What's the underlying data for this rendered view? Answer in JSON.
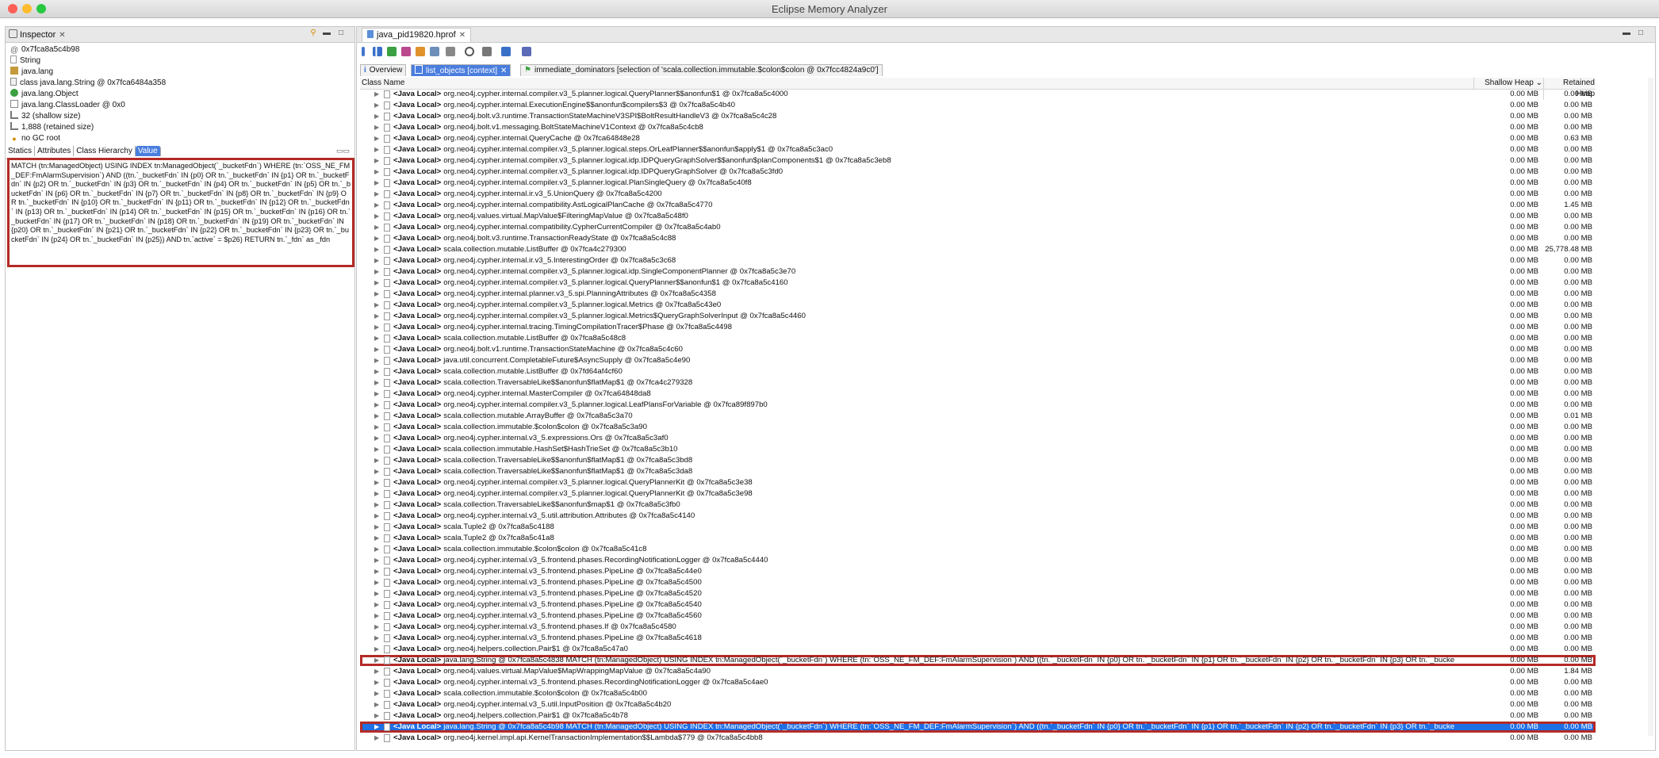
{
  "window": {
    "title": "Eclipse Memory Analyzer"
  },
  "colors": {
    "accent": "#1f6fe5",
    "highlight_outline": "#b32a26",
    "close": "#fd5f57",
    "minimize": "#febc2e",
    "maximize": "#28c840"
  },
  "inspector": {
    "tab_label": "Inspector",
    "lines": [
      {
        "text": "0x7fca8a5c4b98",
        "icon": "address-icon"
      },
      {
        "text": "String",
        "icon": "file-icon"
      },
      {
        "text": "java.lang",
        "icon": "package-icon"
      },
      {
        "text": "class java.lang.String @ 0x7fca6484a358",
        "icon": "class-icon"
      },
      {
        "text": "java.lang.Object",
        "icon": "superclass-icon"
      },
      {
        "text": "java.lang.ClassLoader @ 0x0",
        "icon": "classloader-icon"
      },
      {
        "text": "32 (shallow size)",
        "icon": "size-icon"
      },
      {
        "text": "1,888 (retained size)",
        "icon": "size-icon"
      },
      {
        "text": "no GC root",
        "icon": "gc-root-icon"
      }
    ],
    "subtabs": [
      "Statics",
      "Attributes",
      "Class Hierarchy",
      "Value"
    ],
    "value_text": "MATCH (tn:ManagedObject) USING INDEX tn:ManagedObject(`_bucketFdn`) WHERE (tn:`OSS_NE_FM_DEF:FmAlarmSupervision`) AND ((tn.`_bucketFdn` IN {p0} OR tn.`_bucketFdn` IN {p1} OR tn.`_bucketFdn` IN {p2} OR tn.`_bucketFdn` IN {p3} OR tn.`_bucketFdn` IN {p4} OR tn.`_bucketFdn` IN {p5} OR tn.`_bucketFdn` IN {p6} OR tn.`_bucketFdn` IN {p7} OR tn.`_bucketFdn` IN {p8} OR tn.`_bucketFdn` IN {p9} OR tn.`_bucketFdn` IN {p10} OR tn.`_bucketFdn` IN {p11} OR tn.`_bucketFdn` IN {p12} OR tn.`_bucketFdn` IN {p13} OR tn.`_bucketFdn` IN {p14} OR tn.`_bucketFdn` IN {p15} OR tn.`_bucketFdn` IN {p16} OR tn.`_bucketFdn` IN {p17} OR tn.`_bucketFdn` IN {p18} OR tn.`_bucketFdn` IN {p19} OR tn.`_bucketFdn` IN {p20} OR tn.`_bucketFdn` IN {p21} OR tn.`_bucketFdn` IN {p22} OR tn.`_bucketFdn` IN {p23} OR tn.`_bucketFdn` IN {p24} OR tn.`_bucketFdn` IN {p25}) AND tn.`active` = $p26) RETURN tn.`_fdn` as _fdn"
  },
  "editor": {
    "tab_label": "java_pid19820.hprof",
    "view_tabs": [
      {
        "label": "Overview",
        "icon": "info-icon"
      },
      {
        "label": "list_objects [context]",
        "icon": "list-icon"
      },
      {
        "label": "immediate_dominators [selection of 'scala.collection.immutable.$colon$colon @ 0x7fcc4824a9c0']",
        "icon": "dominator-icon"
      }
    ],
    "columns": {
      "class_name": "Class Name",
      "shallow": "Shallow Heap",
      "retained": "Retained Heap"
    },
    "row_prefix": "<Java Local>",
    "rows": [
      {
        "name": "org.neo4j.cypher.internal.compiler.v3_5.planner.logical.QueryPlanner$$anonfun$1 @ 0x7fca8a5c4000",
        "shallow": "0.00 MB",
        "retained": "0.00 MB"
      },
      {
        "name": "org.neo4j.cypher.internal.ExecutionEngine$$anonfun$compilers$3 @ 0x7fca8a5c4b40",
        "shallow": "0.00 MB",
        "retained": "0.00 MB"
      },
      {
        "name": "org.neo4j.bolt.v3.runtime.TransactionStateMachineV3SPI$BoltResultHandleV3 @ 0x7fca8a5c4c28",
        "shallow": "0.00 MB",
        "retained": "0.00 MB"
      },
      {
        "name": "org.neo4j.bolt.v1.messaging.BoltStateMachineV1Context @ 0x7fca8a5c4cb8",
        "shallow": "0.00 MB",
        "retained": "0.00 MB"
      },
      {
        "name": "org.neo4j.cypher.internal.QueryCache @ 0x7fca64848e28",
        "shallow": "0.00 MB",
        "retained": "0.63 MB"
      },
      {
        "name": "org.neo4j.cypher.internal.compiler.v3_5.planner.logical.steps.OrLeafPlanner$$anonfun$apply$1 @ 0x7fca8a5c3ac0",
        "shallow": "0.00 MB",
        "retained": "0.00 MB"
      },
      {
        "name": "org.neo4j.cypher.internal.compiler.v3_5.planner.logical.idp.IDPQueryGraphSolver$$anonfun$planComponents$1 @ 0x7fca8a5c3eb8",
        "shallow": "0.00 MB",
        "retained": "0.00 MB"
      },
      {
        "name": "org.neo4j.cypher.internal.compiler.v3_5.planner.logical.idp.IDPQueryGraphSolver @ 0x7fca8a5c3fd0",
        "shallow": "0.00 MB",
        "retained": "0.00 MB"
      },
      {
        "name": "org.neo4j.cypher.internal.compiler.v3_5.planner.logical.PlanSingleQuery @ 0x7fca8a5c40f8",
        "shallow": "0.00 MB",
        "retained": "0.00 MB"
      },
      {
        "name": "org.neo4j.cypher.internal.ir.v3_5.UnionQuery @ 0x7fca8a5c4200",
        "shallow": "0.00 MB",
        "retained": "0.00 MB"
      },
      {
        "name": "org.neo4j.cypher.internal.compatibility.AstLogicalPlanCache @ 0x7fca8a5c4770",
        "shallow": "0.00 MB",
        "retained": "1.45 MB"
      },
      {
        "name": "org.neo4j.values.virtual.MapValue$FilteringMapValue @ 0x7fca8a5c48f0",
        "shallow": "0.00 MB",
        "retained": "0.00 MB"
      },
      {
        "name": "org.neo4j.cypher.internal.compatibility.CypherCurrentCompiler @ 0x7fca8a5c4ab0",
        "shallow": "0.00 MB",
        "retained": "0.00 MB"
      },
      {
        "name": "org.neo4j.bolt.v3.runtime.TransactionReadyState @ 0x7fca8a5c4c88",
        "shallow": "0.00 MB",
        "retained": "0.00 MB"
      },
      {
        "name": "scala.collection.mutable.ListBuffer @ 0x7fca4c279300",
        "shallow": "0.00 MB",
        "retained": "25,778.48 MB"
      },
      {
        "name": "org.neo4j.cypher.internal.ir.v3_5.InterestingOrder @ 0x7fca8a5c3c68",
        "shallow": "0.00 MB",
        "retained": "0.00 MB"
      },
      {
        "name": "org.neo4j.cypher.internal.compiler.v3_5.planner.logical.idp.SingleComponentPlanner @ 0x7fca8a5c3e70",
        "shallow": "0.00 MB",
        "retained": "0.00 MB"
      },
      {
        "name": "org.neo4j.cypher.internal.compiler.v3_5.planner.logical.QueryPlanner$$anonfun$1 @ 0x7fca8a5c4160",
        "shallow": "0.00 MB",
        "retained": "0.00 MB"
      },
      {
        "name": "org.neo4j.cypher.internal.planner.v3_5.spi.PlanningAttributes @ 0x7fca8a5c4358",
        "shallow": "0.00 MB",
        "retained": "0.00 MB"
      },
      {
        "name": "org.neo4j.cypher.internal.compiler.v3_5.planner.logical.Metrics @ 0x7fca8a5c43e0",
        "shallow": "0.00 MB",
        "retained": "0.00 MB"
      },
      {
        "name": "org.neo4j.cypher.internal.compiler.v3_5.planner.logical.Metrics$QueryGraphSolverInput @ 0x7fca8a5c4460",
        "shallow": "0.00 MB",
        "retained": "0.00 MB"
      },
      {
        "name": "org.neo4j.cypher.internal.tracing.TimingCompilationTracer$Phase @ 0x7fca8a5c4498",
        "shallow": "0.00 MB",
        "retained": "0.00 MB"
      },
      {
        "name": "scala.collection.mutable.ListBuffer @ 0x7fca8a5c48c8",
        "shallow": "0.00 MB",
        "retained": "0.00 MB"
      },
      {
        "name": "org.neo4j.bolt.v1.runtime.TransactionStateMachine @ 0x7fca8a5c4c60",
        "shallow": "0.00 MB",
        "retained": "0.00 MB"
      },
      {
        "name": "java.util.concurrent.CompletableFuture$AsyncSupply @ 0x7fca8a5c4e90",
        "shallow": "0.00 MB",
        "retained": "0.00 MB"
      },
      {
        "name": "scala.collection.mutable.ListBuffer @ 0x7fd64af4cf60",
        "shallow": "0.00 MB",
        "retained": "0.00 MB"
      },
      {
        "name": "scala.collection.TraversableLike$$anonfun$flatMap$1 @ 0x7fca4c279328",
        "shallow": "0.00 MB",
        "retained": "0.00 MB"
      },
      {
        "name": "org.neo4j.cypher.internal.MasterCompiler @ 0x7fca64848da8",
        "shallow": "0.00 MB",
        "retained": "0.00 MB"
      },
      {
        "name": "org.neo4j.cypher.internal.compiler.v3_5.planner.logical.LeafPlansForVariable @ 0x7fca89f897b0",
        "shallow": "0.00 MB",
        "retained": "0.00 MB"
      },
      {
        "name": "scala.collection.mutable.ArrayBuffer @ 0x7fca8a5c3a70",
        "shallow": "0.00 MB",
        "retained": "0.01 MB"
      },
      {
        "name": "scala.collection.immutable.$colon$colon @ 0x7fca8a5c3a90",
        "shallow": "0.00 MB",
        "retained": "0.00 MB"
      },
      {
        "name": "org.neo4j.cypher.internal.v3_5.expressions.Ors @ 0x7fca8a5c3af0",
        "shallow": "0.00 MB",
        "retained": "0.00 MB"
      },
      {
        "name": "scala.collection.immutable.HashSet$HashTrieSet @ 0x7fca8a5c3b10",
        "shallow": "0.00 MB",
        "retained": "0.00 MB"
      },
      {
        "name": "scala.collection.TraversableLike$$anonfun$flatMap$1 @ 0x7fca8a5c3bd8",
        "shallow": "0.00 MB",
        "retained": "0.00 MB"
      },
      {
        "name": "scala.collection.TraversableLike$$anonfun$flatMap$1 @ 0x7fca8a5c3da8",
        "shallow": "0.00 MB",
        "retained": "0.00 MB"
      },
      {
        "name": "org.neo4j.cypher.internal.compiler.v3_5.planner.logical.QueryPlannerKit @ 0x7fca8a5c3e38",
        "shallow": "0.00 MB",
        "retained": "0.00 MB"
      },
      {
        "name": "org.neo4j.cypher.internal.compiler.v3_5.planner.logical.QueryPlannerKit @ 0x7fca8a5c3e98",
        "shallow": "0.00 MB",
        "retained": "0.00 MB"
      },
      {
        "name": "scala.collection.TraversableLike$$anonfun$map$1 @ 0x7fca8a5c3fb0",
        "shallow": "0.00 MB",
        "retained": "0.00 MB"
      },
      {
        "name": "org.neo4j.cypher.internal.v3_5.util.attribution.Attributes @ 0x7fca8a5c4140",
        "shallow": "0.00 MB",
        "retained": "0.00 MB"
      },
      {
        "name": "scala.Tuple2 @ 0x7fca8a5c4188",
        "shallow": "0.00 MB",
        "retained": "0.00 MB"
      },
      {
        "name": "scala.Tuple2 @ 0x7fca8a5c41a8",
        "shallow": "0.00 MB",
        "retained": "0.00 MB"
      },
      {
        "name": "scala.collection.immutable.$colon$colon @ 0x7fca8a5c41c8",
        "shallow": "0.00 MB",
        "retained": "0.00 MB"
      },
      {
        "name": "org.neo4j.cypher.internal.v3_5.frontend.phases.RecordingNotificationLogger @ 0x7fca8a5c4440",
        "shallow": "0.00 MB",
        "retained": "0.00 MB"
      },
      {
        "name": "org.neo4j.cypher.internal.v3_5.frontend.phases.PipeLine @ 0x7fca8a5c44e0",
        "shallow": "0.00 MB",
        "retained": "0.00 MB"
      },
      {
        "name": "org.neo4j.cypher.internal.v3_5.frontend.phases.PipeLine @ 0x7fca8a5c4500",
        "shallow": "0.00 MB",
        "retained": "0.00 MB"
      },
      {
        "name": "org.neo4j.cypher.internal.v3_5.frontend.phases.PipeLine @ 0x7fca8a5c4520",
        "shallow": "0.00 MB",
        "retained": "0.00 MB"
      },
      {
        "name": "org.neo4j.cypher.internal.v3_5.frontend.phases.PipeLine @ 0x7fca8a5c4540",
        "shallow": "0.00 MB",
        "retained": "0.00 MB"
      },
      {
        "name": "org.neo4j.cypher.internal.v3_5.frontend.phases.PipeLine @ 0x7fca8a5c4560",
        "shallow": "0.00 MB",
        "retained": "0.00 MB"
      },
      {
        "name": "org.neo4j.cypher.internal.v3_5.frontend.phases.If @ 0x7fca8a5c4580",
        "shallow": "0.00 MB",
        "retained": "0.00 MB"
      },
      {
        "name": "org.neo4j.cypher.internal.v3_5.frontend.phases.PipeLine @ 0x7fca8a5c4618",
        "shallow": "0.00 MB",
        "retained": "0.00 MB"
      },
      {
        "name": "org.neo4j.helpers.collection.Pair$1 @ 0x7fca8a5c47a0",
        "shallow": "0.00 MB",
        "retained": "0.00 MB"
      },
      {
        "name": "java.lang.String @ 0x7fca8a5c4838  MATCH (tn:ManagedObject) USING INDEX tn:ManagedObject(`_bucketFdn`) WHERE (tn:`OSS_NE_FM_DEF:FmAlarmSupervision`) AND ((tn.`_bucketFdn` IN {p0} OR tn.`_bucketFdn` IN {p1} OR tn.`_bucketFdn` IN {p2} OR tn.`_bucketFdn` IN {p3} OR tn.`_bucke",
        "shallow": "0.00 MB",
        "retained": "0.00 MB",
        "outlined": true
      },
      {
        "name": "org.neo4j.values.virtual.MapValue$MapWrappingMapValue @ 0x7fca8a5c4a90",
        "shallow": "0.00 MB",
        "retained": "1.84 MB"
      },
      {
        "name": "org.neo4j.cypher.internal.v3_5.frontend.phases.RecordingNotificationLogger @ 0x7fca8a5c4ae0",
        "shallow": "0.00 MB",
        "retained": "0.00 MB"
      },
      {
        "name": "scala.collection.immutable.$colon$colon @ 0x7fca8a5c4b00",
        "shallow": "0.00 MB",
        "retained": "0.00 MB"
      },
      {
        "name": "org.neo4j.cypher.internal.v3_5.util.InputPosition @ 0x7fca8a5c4b20",
        "shallow": "0.00 MB",
        "retained": "0.00 MB"
      },
      {
        "name": "org.neo4j.helpers.collection.Pair$1 @ 0x7fca8a5c4b78",
        "shallow": "0.00 MB",
        "retained": "0.00 MB"
      },
      {
        "name": "java.lang.String @ 0x7fca8a5c4b98  MATCH (tn:ManagedObject) USING INDEX tn:ManagedObject(`_bucketFdn`) WHERE (tn:`OSS_NE_FM_DEF:FmAlarmSupervision`) AND ((tn.`_bucketFdn` IN {p0} OR tn.`_bucketFdn` IN {p1} OR tn.`_bucketFdn` IN {p2} OR tn.`_bucketFdn` IN {p3} OR tn.`_bucke",
        "shallow": "0.00 MB",
        "retained": "0.00 MB",
        "selected": true,
        "outlined": true
      },
      {
        "name": "org.neo4j.kernel.impl.api.KernelTransactionImplementation$$Lambda$779 @ 0x7fca8a5c4bb8",
        "shallow": "0.00 MB",
        "retained": "0.00 MB"
      }
    ]
  }
}
